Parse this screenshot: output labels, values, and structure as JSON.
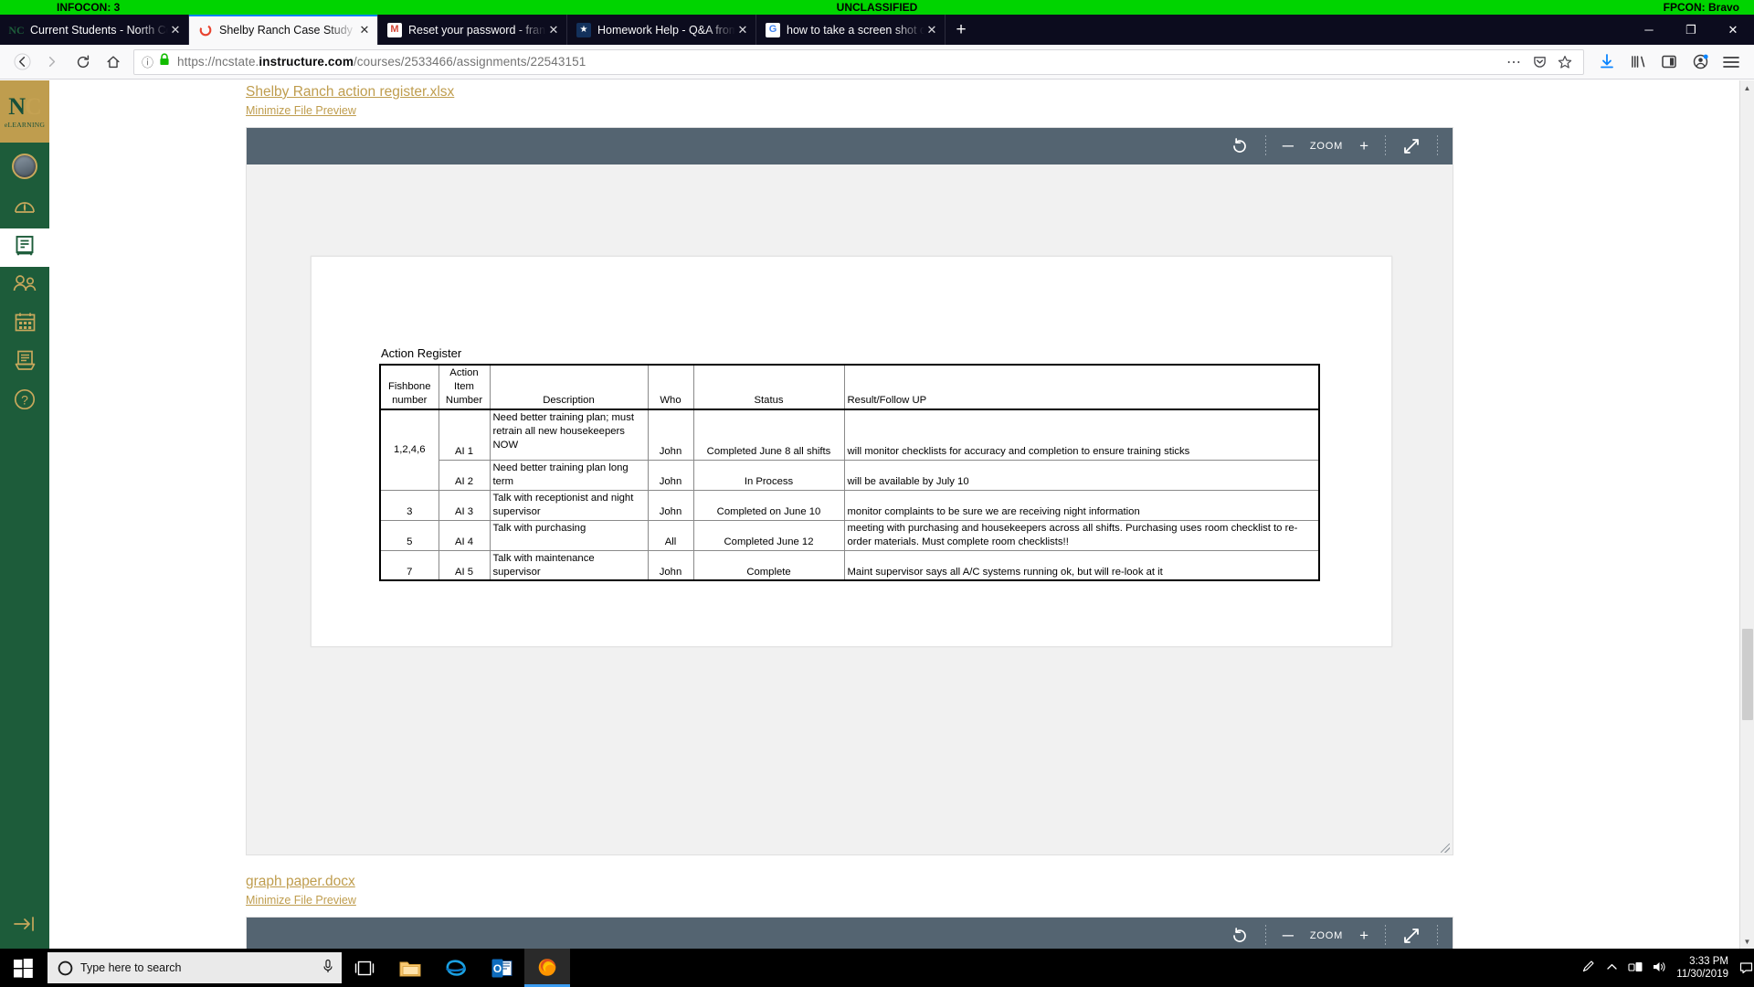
{
  "classification_banner": {
    "left": "INFOCON: 3",
    "center": "UNCLASSIFIED",
    "right": "FPCON: Bravo"
  },
  "browser": {
    "tabs": [
      {
        "title": "Current Students - North Centr",
        "favicon": "nc-logo-icon",
        "active": false
      },
      {
        "title": "Shelby Ranch Case Study",
        "favicon": "canvas-loading-icon",
        "active": true
      },
      {
        "title": "Reset your password - frank.v.w",
        "favicon": "gmail-icon",
        "active": false
      },
      {
        "title": "Homework Help - Q&A from O",
        "favicon": "coursehero-star-icon",
        "active": false
      },
      {
        "title": "how to take a screen shot on sa",
        "favicon": "google-icon",
        "active": false
      }
    ],
    "new_tab_label": "+",
    "close_label": "✕",
    "window_controls": {
      "minimize": "─",
      "restore": "❐",
      "close": "✕"
    },
    "nav": {
      "back": "←",
      "forward": "→",
      "reload": "↻",
      "home": "⌂"
    },
    "url": {
      "scheme": "https://ncstate.",
      "domain": "instructure.com",
      "path": "/courses/2533466/assignments/22543151",
      "full": "https://ncstate.instructure.com/courses/2533466/assignments/22543151",
      "security_icon": "lock-icon",
      "page_info_icon": "info-circle-icon"
    },
    "urlbar_icons": {
      "more": "⋯",
      "pocket": "pocket-icon",
      "bookmark": "star-icon"
    },
    "toolbar_icons": {
      "downloads": "download-arrow-icon",
      "library": "library-icon",
      "sidebar": "sidebar-icon",
      "account": "account-icon",
      "menu": "hamburger-menu-icon"
    }
  },
  "canvas_nav": {
    "logo": {
      "mark": "NC",
      "subtitle": "eLEARNING"
    },
    "items": [
      {
        "name": "account",
        "icon": "user-avatar-icon"
      },
      {
        "name": "dashboard",
        "icon": "dashboard-gauge-icon"
      },
      {
        "name": "courses",
        "icon": "courses-book-icon",
        "active": true
      },
      {
        "name": "groups",
        "icon": "groups-people-icon"
      },
      {
        "name": "calendar",
        "icon": "calendar-icon"
      },
      {
        "name": "inbox",
        "icon": "inbox-tray-icon"
      },
      {
        "name": "help",
        "icon": "help-question-icon"
      }
    ],
    "collapse_label": "→|"
  },
  "previews": [
    {
      "file_name": "Shelby Ranch action register.xlsx",
      "minimize_label": "Minimize File Preview",
      "toolbar": {
        "rotate_icon": "rotate-icon",
        "zoom_out_label": "─",
        "zoom_label": "ZOOM",
        "zoom_in_label": "+",
        "fullscreen_icon": "fullscreen-arrows-icon"
      }
    },
    {
      "file_name": "graph paper.docx",
      "minimize_label": "Minimize File Preview",
      "toolbar": {
        "rotate_icon": "rotate-icon",
        "zoom_out_label": "─",
        "zoom_label": "ZOOM",
        "zoom_in_label": "+",
        "fullscreen_icon": "fullscreen-arrows-icon"
      }
    }
  ],
  "spreadsheet": {
    "title": "Action Register",
    "headers": [
      "Fishbone number",
      "Action Item Number",
      "Description",
      "Who",
      "Status",
      "Result/Follow UP"
    ],
    "rows": [
      {
        "fishbone": "1,2,4,6",
        "action_item": "AI 1",
        "description": "Need better training plan; must retrain all new housekeepers NOW",
        "who": "John",
        "status": "Completed June 8 all shifts",
        "result": "will monitor checklists for accuracy and completion to ensure training sticks"
      },
      {
        "fishbone": "",
        "action_item": "AI 2",
        "description": "Need better training plan long term",
        "who": "John",
        "status": "In Process",
        "result": "will be available by July 10"
      },
      {
        "fishbone": "3",
        "action_item": "AI 3",
        "description": "Talk with receptionist and night supervisor",
        "who": "John",
        "status": "Completed on June 10",
        "result": "monitor complaints to be sure we are receiving night information"
      },
      {
        "fishbone": "5",
        "action_item": "AI 4",
        "description": "Talk with purchasing",
        "who": "All",
        "status": "Completed June 12",
        "result": "meeting with purchasing and housekeepers across all shifts.  Purchasing uses room checklist to re-order materials.  Must complete room checklists!!"
      },
      {
        "fishbone": "7",
        "action_item": "AI 5",
        "description": "Talk with maintenance supervisor",
        "who": "John",
        "status": "Complete",
        "result": "Maint supervisor says all A/C systems running ok, but will re-look at it"
      }
    ]
  },
  "taskbar": {
    "start_icon": "windows-start-icon",
    "search_placeholder": "Type here to search",
    "cortana_icon": "cortana-circle-icon",
    "mic_icon": "microphone-icon",
    "taskview_icon": "task-view-icon",
    "apps": [
      {
        "name": "file-explorer",
        "icon": "folder-icon"
      },
      {
        "name": "internet-explorer",
        "icon": "ie-icon"
      },
      {
        "name": "outlook",
        "icon": "outlook-icon"
      },
      {
        "name": "firefox",
        "icon": "firefox-icon",
        "running": true
      }
    ],
    "tray": {
      "pen_icon": "pen-icon",
      "chevron_icon": "⌃",
      "network_icon": "network-icon",
      "volume_icon": "volume-icon",
      "time": "3:33 PM",
      "date": "11/30/2019",
      "notification_icon": "notification-icon"
    }
  },
  "colors": {
    "banner_green": "#00d400",
    "canvas_green": "#1d5c3a",
    "canvas_gold": "#bf9d4e",
    "preview_toolbar": "#546471",
    "tab_active_accent": "#0a84ff"
  }
}
